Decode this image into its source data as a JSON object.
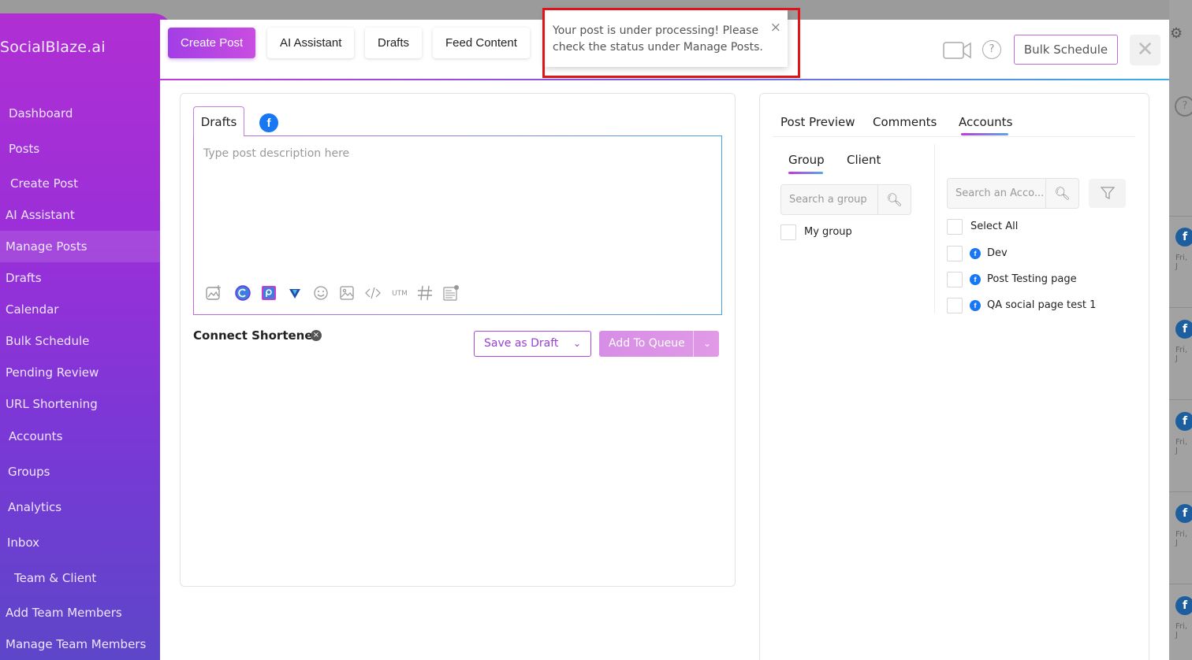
{
  "app": {
    "logo": "SocialBlaze.ai"
  },
  "sidebar": {
    "items": [
      {
        "label": "Dashboard"
      },
      {
        "label": "Posts"
      },
      {
        "label": "Create Post"
      },
      {
        "label": "AI Assistant"
      },
      {
        "label": "Manage Posts"
      },
      {
        "label": "Drafts"
      },
      {
        "label": "Calendar"
      },
      {
        "label": "Bulk Schedule"
      },
      {
        "label": "Pending Review"
      },
      {
        "label": "URL Shortening"
      },
      {
        "label": "Accounts"
      },
      {
        "label": "Groups"
      },
      {
        "label": "Analytics"
      },
      {
        "label": "Inbox"
      },
      {
        "label": "Team & Client"
      },
      {
        "label": "Add Team Members"
      },
      {
        "label": "Manage Team Members"
      }
    ]
  },
  "modal": {
    "tabs": [
      {
        "label": "Create Post"
      },
      {
        "label": "AI Assistant"
      },
      {
        "label": "Drafts"
      },
      {
        "label": "Feed Content"
      }
    ],
    "bulk_schedule_label": "Bulk Schedule",
    "close_symbol": "✕",
    "help_symbol": "?"
  },
  "toast": {
    "message": "Your post is under processing! Please check the status under Manage Posts.",
    "close_symbol": "×"
  },
  "editor": {
    "drafts_tab": "Drafts",
    "fb_icon_letter": "f",
    "placeholder": "Type post description here",
    "connect_shortener": "Connect Shortener",
    "connect_close": "×",
    "utm_label": "UTM",
    "save_draft_label": "Save as Draft",
    "add_queue_label": "Add To Queue"
  },
  "accounts_panel": {
    "tabs": [
      {
        "label": "Post Preview"
      },
      {
        "label": "Comments"
      },
      {
        "label": "Accounts"
      }
    ],
    "sub_tabs": [
      {
        "label": "Group"
      },
      {
        "label": "Client"
      }
    ],
    "group_search_placeholder": "Search a group",
    "account_search_placeholder": "Search an Acco...",
    "groups": [
      {
        "label": "My group"
      }
    ],
    "select_all_label": "Select All",
    "accounts": [
      {
        "label": "Dev"
      },
      {
        "label": "Post Testing page"
      },
      {
        "label": "QA social page test 1"
      }
    ]
  },
  "background": {
    "help_symbol": "?",
    "fb_letter": "f",
    "date_snippet": "Fri, J"
  },
  "colors": {
    "accent_purple": "#a23ee6",
    "toast_highlight": "#e0131a",
    "facebook_blue": "#1877f2"
  }
}
